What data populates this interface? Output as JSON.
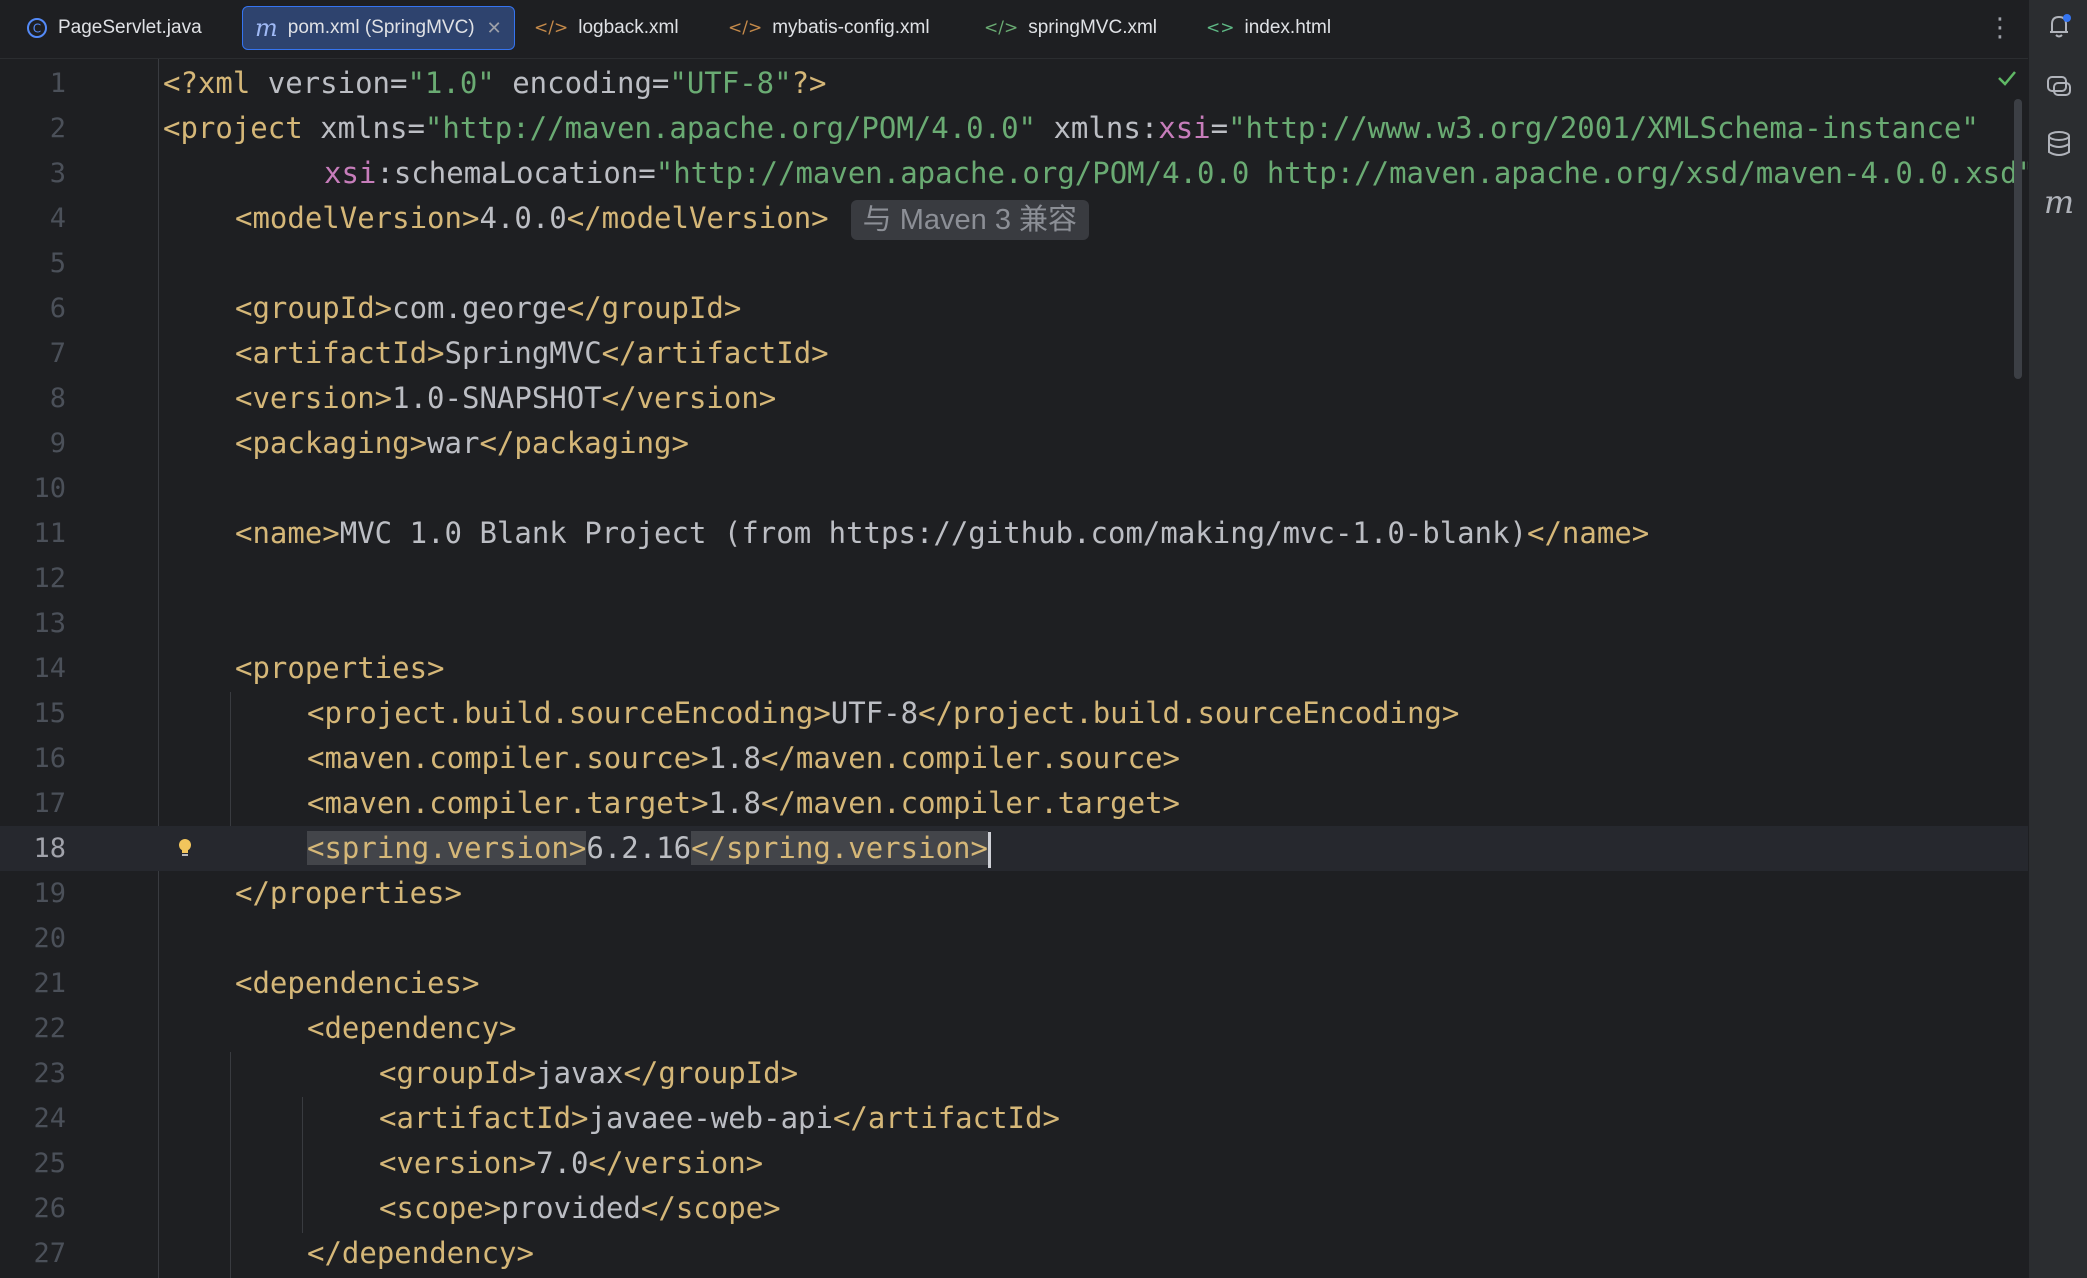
{
  "tabs": [
    {
      "label": "PageServlet.java",
      "icon": "java-class-icon",
      "active": false
    },
    {
      "label": "pom.xml (SpringMVC)",
      "icon": "maven-icon",
      "active": true
    },
    {
      "label": "logback.xml",
      "icon": "xml-icon",
      "active": false
    },
    {
      "label": "mybatis-config.xml",
      "icon": "xml-icon",
      "active": false
    },
    {
      "label": "springMVC.xml",
      "icon": "spring-xml-icon",
      "active": false
    },
    {
      "label": "index.html",
      "icon": "html-icon",
      "active": false
    }
  ],
  "editor": {
    "line_numbers": [
      "1",
      "2",
      "3",
      "4",
      "5",
      "6",
      "7",
      "8",
      "9",
      "10",
      "11",
      "12",
      "13",
      "14",
      "15",
      "16",
      "17",
      "18",
      "19",
      "20",
      "21",
      "22",
      "23",
      "24",
      "25",
      "26",
      "27"
    ],
    "current_line": "18",
    "inlay_hint": "与 Maven 3 兼容",
    "lines": {
      "l1": {
        "a": "<?xml ",
        "b": "version",
        "c": "=",
        "d": "\"1.0\"",
        "e": " encoding",
        "f": "=",
        "g": "\"UTF-8\"",
        "h": "?>"
      },
      "l2": {
        "a": "<project ",
        "b": "xmlns",
        "c": "=",
        "d": "\"http://maven.apache.org/POM/4.0.0\"",
        "e": " xmlns:",
        "f": "xsi",
        "g": "=",
        "h": "\"http://www.w3.org/2001/XMLSchema-instance\""
      },
      "l3": {
        "a": "xsi",
        "b": ":schemaLocation",
        "c": "=",
        "d": "\"http://maven.apache.org/POM/4.0.0 http://maven.apache.org/xsd/maven-4.0.0.xsd\""
      },
      "l4": {
        "a": "<modelVersion>",
        "b": "4.0.0",
        "c": "</modelVersion>"
      },
      "l6": {
        "a": "<groupId>",
        "b": "com.george",
        "c": "</groupId>"
      },
      "l7": {
        "a": "<artifactId>",
        "b": "SpringMVC",
        "c": "</artifactId>"
      },
      "l8": {
        "a": "<version>",
        "b": "1.0-SNAPSHOT",
        "c": "</version>"
      },
      "l9": {
        "a": "<packaging>",
        "b": "war",
        "c": "</packaging>"
      },
      "l11": {
        "a": "<name>",
        "b": "MVC 1.0 Blank Project (from https://github.com/making/mvc-1.0-blank)",
        "c": "</name>"
      },
      "l14": {
        "a": "<properties>"
      },
      "l15": {
        "a": "<project.build.sourceEncoding>",
        "b": "UTF-8",
        "c": "</project.build.sourceEncoding>"
      },
      "l16": {
        "a": "<maven.compiler.source>",
        "b": "1.8",
        "c": "</maven.compiler.source>"
      },
      "l17": {
        "a": "<maven.compiler.target>",
        "b": "1.8",
        "c": "</maven.compiler.target>"
      },
      "l18": {
        "a": "<spring.version>",
        "b": "6.2.16",
        "c": "</spring.version>"
      },
      "l19": {
        "a": "</properties>"
      },
      "l21": {
        "a": "<dependencies>"
      },
      "l22": {
        "a": "<dependency>"
      },
      "l23": {
        "a": "<groupId>",
        "b": "javax",
        "c": "</groupId>"
      },
      "l24": {
        "a": "<artifactId>",
        "b": "javaee-web-api",
        "c": "</artifactId>"
      },
      "l25": {
        "a": "<version>",
        "b": "7.0",
        "c": "</version>"
      },
      "l26": {
        "a": "<scope>",
        "b": "provided",
        "c": "</scope>"
      },
      "l27": {
        "a": "</dependency>"
      }
    }
  },
  "right_toolbar": [
    "notifications-icon",
    "ai-assistant-icon",
    "database-icon",
    "maven-icon"
  ],
  "colors": {
    "tag": "#d5b778",
    "value": "#6aab73",
    "namespace": "#c77dbb",
    "accent": "#3574f0",
    "background": "#1e1f22"
  }
}
